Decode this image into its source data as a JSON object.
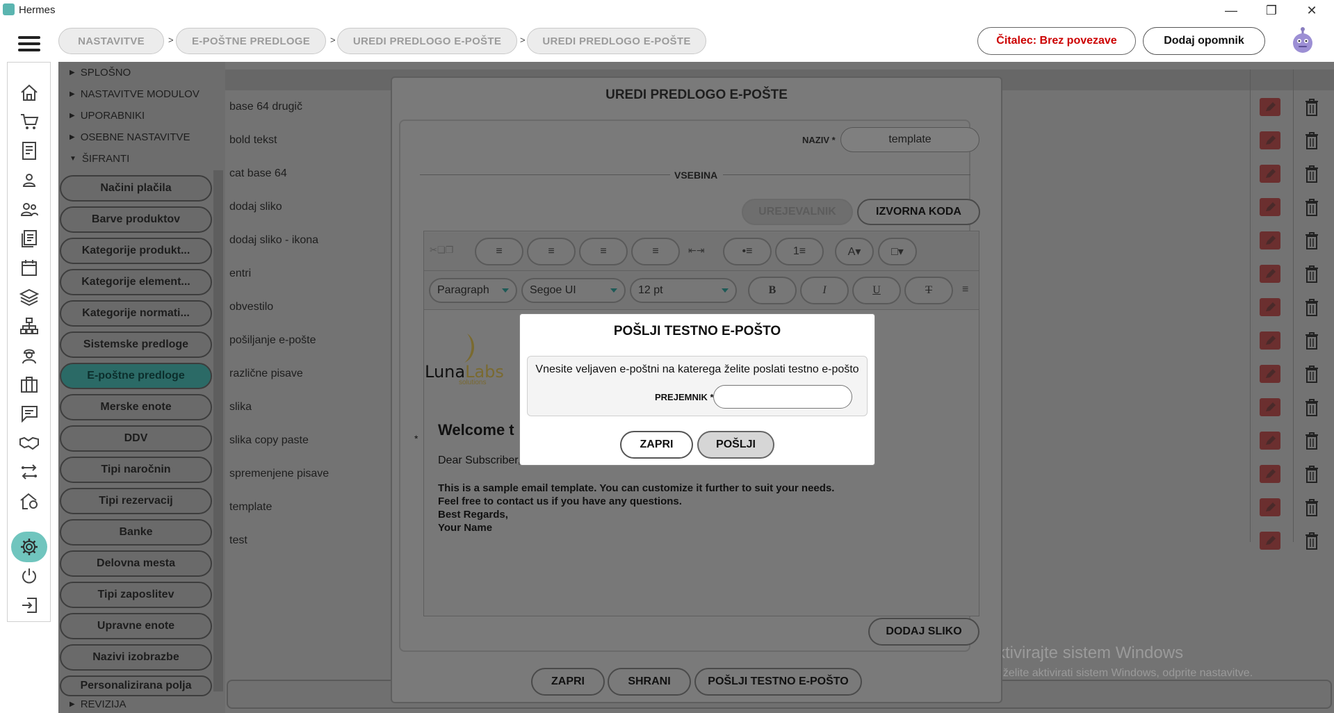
{
  "window": {
    "title": "Hermes"
  },
  "breadcrumbs": [
    "NASTAVITVE",
    "E-POŠTNE PREDLOGE",
    "UREDI PREDLOGO E-POŠTE",
    "UREDI PREDLOGO E-POŠTE"
  ],
  "header": {
    "reader_status": "Čitalec: Brez povezave",
    "add_reminder": "Dodaj opomnik",
    "reader_status_color": "#cc0000"
  },
  "tree": {
    "categories": [
      "SPLOŠNO",
      "NASTAVITVE MODULOV",
      "UPORABNIKI",
      "OSEBNE NASTAVITVE",
      "ŠIFRANTI"
    ],
    "items": [
      "Načini plačila",
      "Barve produktov",
      "Kategorije produkt...",
      "Kategorije element...",
      "Kategorije normati...",
      "Sistemske predloge",
      "E-poštne predloge",
      "Merske enote",
      "DDV",
      "Tipi naročnin",
      "Tipi rezervacij",
      "Banke",
      "Delovna mesta",
      "Tipi zaposlitev",
      "Upravne enote",
      "Nazivi izobrazbe",
      "Personalizirana polja"
    ],
    "active_item": "E-poštne predloge",
    "bottom_category": "REVIZIJA"
  },
  "templates": [
    "base 64 drugič",
    "bold tekst",
    "cat base 64",
    "dodaj sliko",
    "dodaj sliko - ikona",
    "entri",
    "obvestilo",
    "pošiljanje e-pošte",
    "različne pisave",
    "slika",
    "slika copy paste",
    "spremenjene pisave",
    "template",
    "test"
  ],
  "edit_modal": {
    "title": "UREDI PREDLOGO E-POŠTE",
    "name_label": "NAZIV *",
    "name_value": "template",
    "content_label": "VSEBINA",
    "tab_editor": "UREJEVALNIK",
    "tab_source": "IZVORNA KODA",
    "format_select": "Paragraph",
    "font_select": "Segoe UI",
    "size_select": "12 pt",
    "add_image": "DODAJ SLIKO",
    "close": "ZAPRI",
    "save": "SHRANI",
    "send_test": "POŠLJI TESTNO E-POŠTO"
  },
  "email_preview": {
    "logo_luna": "Luna",
    "logo_labs": "Labs",
    "logo_sub": "solutions",
    "heading": "Welcome t",
    "greeting": "Dear Subscriber,",
    "line1": "This is a sample email template. You can customize it further to suit your needs.",
    "line2": "Feel free to contact us if you have any questions.",
    "line3": "Best Regards,",
    "line4": "Your Name",
    "asterisk": "*"
  },
  "test_dialog": {
    "title": "POŠLJI TESTNO E-POŠTO",
    "description": "Vnesite veljaven e-poštni na katerega želite poslati testno e-pošto",
    "recipient_label": "PREJEMNIK *",
    "recipient_value": "",
    "close": "ZAPRI",
    "send": "POŠLJI"
  },
  "watermark": {
    "line1": "Aktivirajte sistem Windows",
    "line2": "Če želite aktivirati sistem Windows, odprite nastavitve."
  },
  "colors": {
    "accent": "#70c5be",
    "overlay": "#737373"
  }
}
